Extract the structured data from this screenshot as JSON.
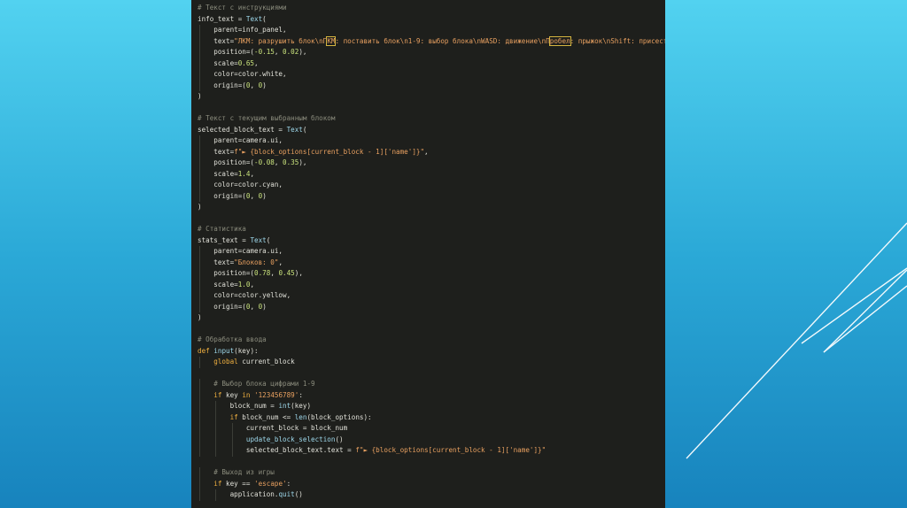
{
  "colors": {
    "editor_bg": "#1e1f1c",
    "comment": "#8b8c7d",
    "keyword": "#f0b040",
    "function": "#9dd7ea",
    "string": "#e8a060",
    "number": "#c9e27c"
  },
  "code_lines": [
    [
      {
        "t": "cm",
        "v": "# Текст с инструкциями"
      }
    ],
    [
      {
        "t": "id",
        "v": "info_text = "
      },
      {
        "t": "fn",
        "v": "Text"
      },
      {
        "t": "op",
        "v": "("
      }
    ],
    [
      {
        "t": "id",
        "v": "    parent=info_panel,"
      }
    ],
    [
      {
        "t": "id",
        "v": "    text="
      },
      {
        "t": "str",
        "v": "\"ЛКМ: разрушить блок\\nП"
      },
      {
        "t": "str",
        "hl": true,
        "v": "КМ"
      },
      {
        "t": "str",
        "v": ": поставить блок\\n1-9: выбор блока\\nWASD: движение\\nП"
      },
      {
        "t": "str",
        "hl": true,
        "v": "робел"
      },
      {
        "t": "str",
        "v": ": прыжок\\nShift: присесть\""
      },
      {
        "t": "op",
        "v": ","
      }
    ],
    [
      {
        "t": "id",
        "v": "    position=("
      },
      {
        "t": "num",
        "v": "-0.15"
      },
      {
        "t": "id",
        "v": ", "
      },
      {
        "t": "num",
        "v": "0.02"
      },
      {
        "t": "id",
        "v": "),"
      }
    ],
    [
      {
        "t": "id",
        "v": "    scale="
      },
      {
        "t": "num",
        "v": "0.65"
      },
      {
        "t": "id",
        "v": ","
      }
    ],
    [
      {
        "t": "id",
        "v": "    color=color.white,"
      }
    ],
    [
      {
        "t": "id",
        "v": "    origin=("
      },
      {
        "t": "num",
        "v": "0"
      },
      {
        "t": "id",
        "v": ", "
      },
      {
        "t": "num",
        "v": "0"
      },
      {
        "t": "id",
        "v": ")"
      }
    ],
    [
      {
        "t": "op",
        "v": ")"
      }
    ],
    [],
    [
      {
        "t": "cm",
        "v": "# Текст с текущим выбранным блоком"
      }
    ],
    [
      {
        "t": "id",
        "v": "selected_block_text = "
      },
      {
        "t": "fn",
        "v": "Text"
      },
      {
        "t": "op",
        "v": "("
      }
    ],
    [
      {
        "t": "id",
        "v": "    parent=camera.ui,"
      }
    ],
    [
      {
        "t": "id",
        "v": "    text="
      },
      {
        "t": "str",
        "v": "f\"► {block_options[current_block - 1]['name']}\""
      },
      {
        "t": "op",
        "v": ","
      }
    ],
    [
      {
        "t": "id",
        "v": "    position=("
      },
      {
        "t": "num",
        "v": "-0.08"
      },
      {
        "t": "id",
        "v": ", "
      },
      {
        "t": "num",
        "v": "0.35"
      },
      {
        "t": "id",
        "v": "),"
      }
    ],
    [
      {
        "t": "id",
        "v": "    scale="
      },
      {
        "t": "num",
        "v": "1.4"
      },
      {
        "t": "id",
        "v": ","
      }
    ],
    [
      {
        "t": "id",
        "v": "    color=color.cyan,"
      }
    ],
    [
      {
        "t": "id",
        "v": "    origin=("
      },
      {
        "t": "num",
        "v": "0"
      },
      {
        "t": "id",
        "v": ", "
      },
      {
        "t": "num",
        "v": "0"
      },
      {
        "t": "id",
        "v": ")"
      }
    ],
    [
      {
        "t": "op",
        "v": ")"
      }
    ],
    [],
    [
      {
        "t": "cm",
        "v": "# Статистика"
      }
    ],
    [
      {
        "t": "id",
        "v": "stats_text = "
      },
      {
        "t": "fn",
        "v": "Text"
      },
      {
        "t": "op",
        "v": "("
      }
    ],
    [
      {
        "t": "id",
        "v": "    parent=camera.ui,"
      }
    ],
    [
      {
        "t": "id",
        "v": "    text="
      },
      {
        "t": "str",
        "v": "\"Блоков: 0\""
      },
      {
        "t": "op",
        "v": ","
      }
    ],
    [
      {
        "t": "id",
        "v": "    position=("
      },
      {
        "t": "num",
        "v": "0.78"
      },
      {
        "t": "id",
        "v": ", "
      },
      {
        "t": "num",
        "v": "0.45"
      },
      {
        "t": "id",
        "v": "),"
      }
    ],
    [
      {
        "t": "id",
        "v": "    scale="
      },
      {
        "t": "num",
        "v": "1.0"
      },
      {
        "t": "id",
        "v": ","
      }
    ],
    [
      {
        "t": "id",
        "v": "    color=color.yellow,"
      }
    ],
    [
      {
        "t": "id",
        "v": "    origin=("
      },
      {
        "t": "num",
        "v": "0"
      },
      {
        "t": "id",
        "v": ", "
      },
      {
        "t": "num",
        "v": "0"
      },
      {
        "t": "id",
        "v": ")"
      }
    ],
    [
      {
        "t": "op",
        "v": ")"
      }
    ],
    [],
    [
      {
        "t": "cm",
        "v": "# Обработка ввода"
      }
    ],
    [
      {
        "t": "kw",
        "v": "def "
      },
      {
        "t": "fn",
        "v": "input"
      },
      {
        "t": "id",
        "v": "(key):"
      }
    ],
    [
      {
        "t": "kw",
        "v": "    global "
      },
      {
        "t": "id",
        "v": "current_block"
      }
    ],
    [],
    [
      {
        "t": "cm",
        "v": "    # Выбор блока цифрами 1-9"
      }
    ],
    [
      {
        "t": "kw",
        "v": "    if "
      },
      {
        "t": "id",
        "v": "key "
      },
      {
        "t": "kw",
        "v": "in "
      },
      {
        "t": "str",
        "v": "'123456789'"
      },
      {
        "t": "id",
        "v": ":"
      }
    ],
    [
      {
        "t": "id",
        "v": "        block_num = "
      },
      {
        "t": "fn",
        "v": "int"
      },
      {
        "t": "id",
        "v": "(key)"
      }
    ],
    [
      {
        "t": "kw",
        "v": "        if "
      },
      {
        "t": "id",
        "v": "block_num <= "
      },
      {
        "t": "fn",
        "v": "len"
      },
      {
        "t": "id",
        "v": "(block_options):"
      }
    ],
    [
      {
        "t": "id",
        "v": "            current_block = block_num"
      }
    ],
    [
      {
        "t": "id",
        "v": "            "
      },
      {
        "t": "fn",
        "v": "update_block_selection"
      },
      {
        "t": "id",
        "v": "()"
      }
    ],
    [
      {
        "t": "id",
        "v": "            selected_block_text.text = "
      },
      {
        "t": "str",
        "v": "f\"► {block_options[current_block - 1]['name']}\""
      }
    ],
    [],
    [
      {
        "t": "cm",
        "v": "    # Выход из игры"
      }
    ],
    [
      {
        "t": "kw",
        "v": "    if "
      },
      {
        "t": "id",
        "v": "key == "
      },
      {
        "t": "str",
        "v": "'escape'"
      },
      {
        "t": "id",
        "v": ":"
      }
    ],
    [
      {
        "t": "id",
        "v": "        application."
      },
      {
        "t": "fn",
        "v": "quit"
      },
      {
        "t": "id",
        "v": "()"
      }
    ]
  ]
}
